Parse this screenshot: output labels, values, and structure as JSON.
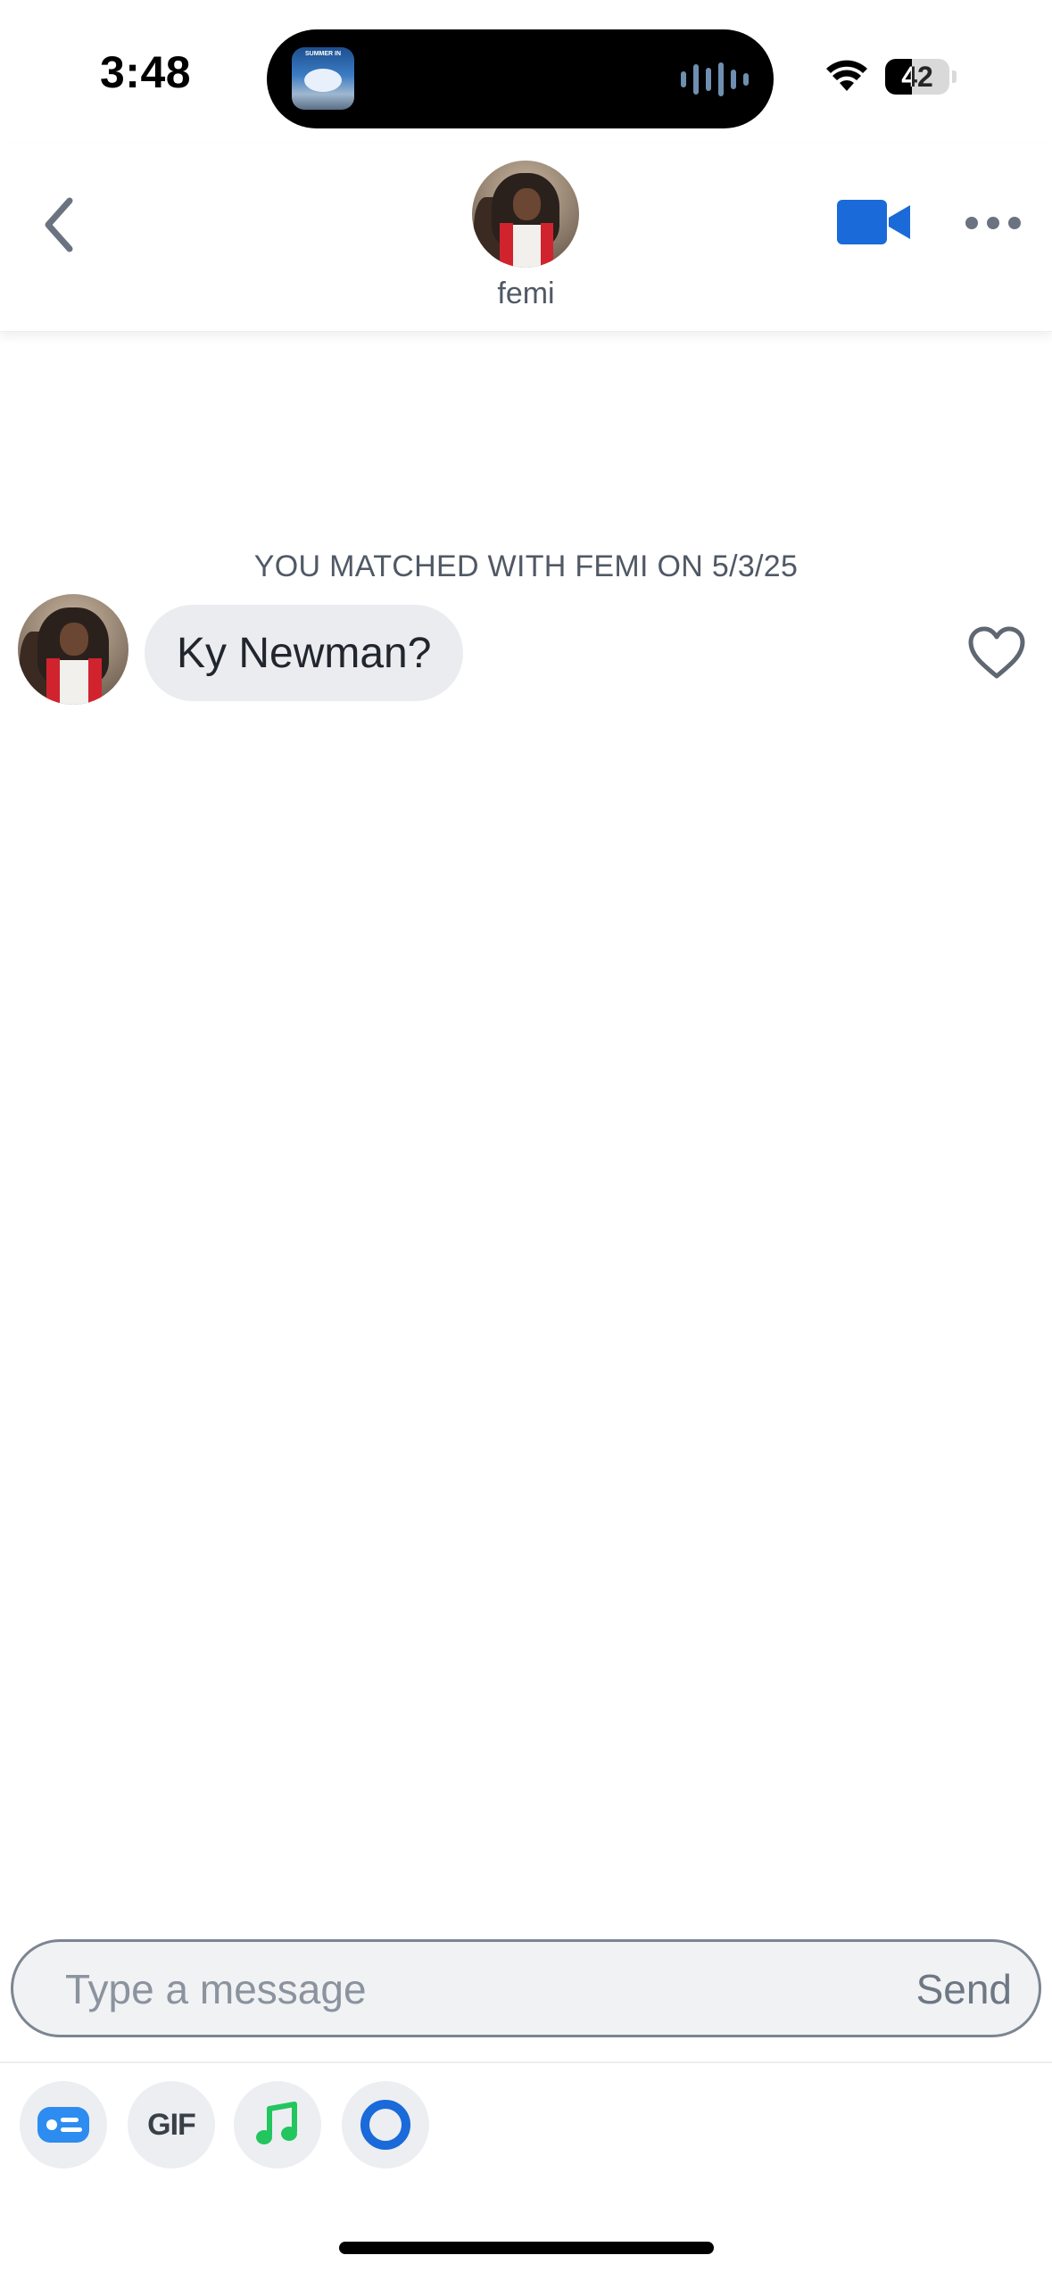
{
  "status_bar": {
    "time": "3:48",
    "battery_level": "42",
    "live_activity_app_text": "SUMMER IN"
  },
  "header": {
    "back_icon": "chevron-left-icon",
    "profile_name": "femi",
    "video_icon": "video-camera-icon",
    "more_icon": "ellipsis-icon",
    "accent_color": "#1a6ad9"
  },
  "chat": {
    "match_notice": "YOU MATCHED WITH FEMI ON 5/3/25",
    "messages": [
      {
        "sender": "femi",
        "text": "Ky Newman?",
        "liked": false
      }
    ]
  },
  "composer": {
    "placeholder": "Type a message",
    "value": "",
    "send_label": "Send"
  },
  "toolbar": {
    "items": [
      {
        "icon": "sticker-card-icon"
      },
      {
        "icon": "gif-icon",
        "label": "GIF"
      },
      {
        "icon": "music-note-icon"
      },
      {
        "icon": "ring-icon"
      }
    ]
  }
}
